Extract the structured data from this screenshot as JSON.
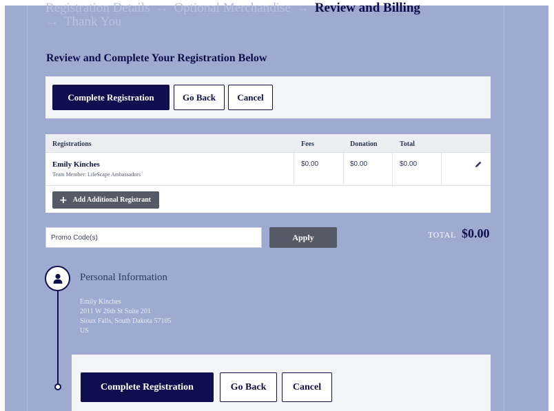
{
  "steps": {
    "step1": "Registration Details",
    "step2": "Optional Merchandise",
    "step3": "Review and Billing",
    "step4": "Thank You",
    "arrow": "→"
  },
  "heading": "Review and Complete Your Registration Below",
  "top_actions": {
    "complete": "Complete Registration",
    "back": "Go Back",
    "cancel": "Cancel"
  },
  "table": {
    "headers": {
      "registrations": "Registrations",
      "fees": "Fees",
      "donation": "Donation",
      "total": "Total"
    },
    "rows": [
      {
        "name": "Emily Kinches",
        "team": "Team Member: LifeScape Ambassadors",
        "fees": "$0.00",
        "donation": "$0.00",
        "total": "$0.00",
        "edit_icon": "pencil-icon"
      }
    ],
    "add_registrant": "Add Additional Registrant",
    "add_icon": "plus-icon"
  },
  "promo": {
    "placeholder": "Promo Code(s)",
    "apply": "Apply"
  },
  "total": {
    "label": "TOTAL",
    "value": "$0.00"
  },
  "personal": {
    "icon": "user-icon",
    "title": "Personal Information",
    "name": "Emily Kinches",
    "address1": "2011 W 26th St Suite 201",
    "address2": "Sioux Falls, South Dakota 57105",
    "country": "US"
  },
  "bottom_actions": {
    "complete": "Complete Registration",
    "back": "Go Back",
    "cancel": "Cancel"
  },
  "colors": {
    "page_bg": "#9eaad0",
    "primary": "#0f0f50",
    "secondary_button": "#555b66"
  }
}
